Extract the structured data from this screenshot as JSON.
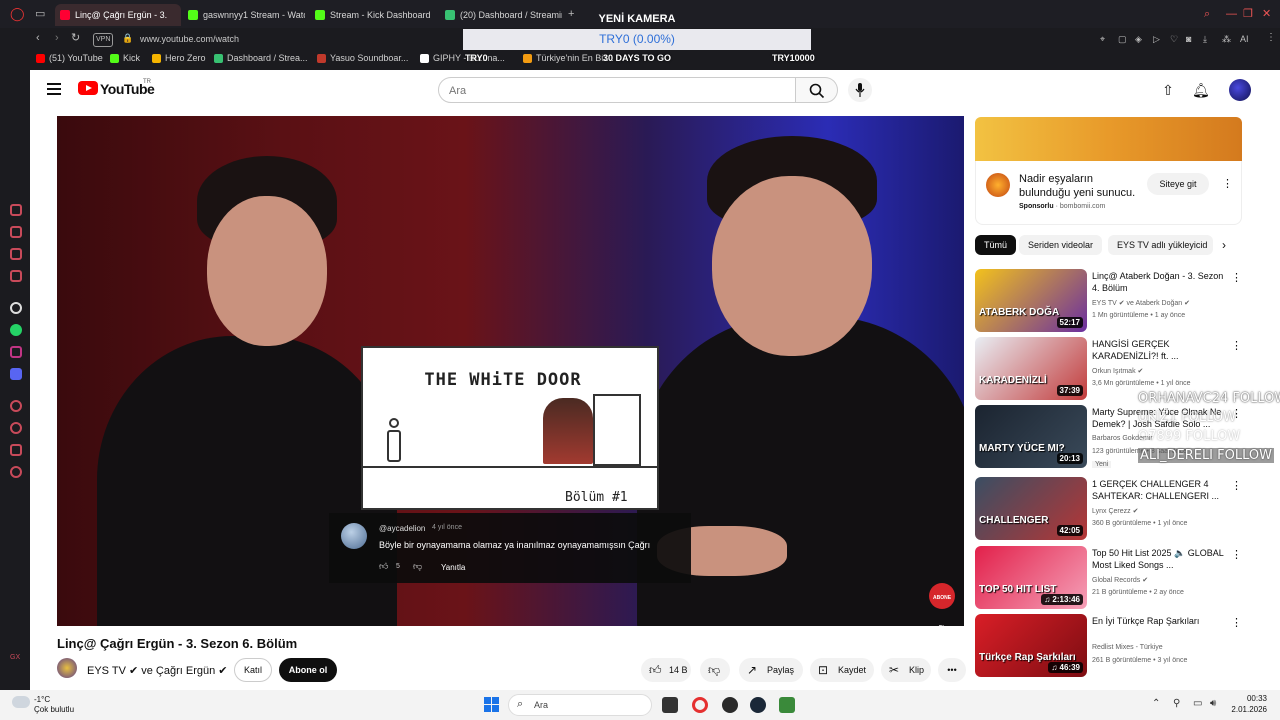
{
  "browser": {
    "tabs": [
      {
        "label": "Linç@ Çağrı Ergün - 3.",
        "active": true,
        "color": "#ff0033"
      },
      {
        "label": "gaswnnyy1 Stream - Watc",
        "active": false,
        "color": "#53fc18"
      },
      {
        "label": "Stream - Kick Dashboard",
        "active": false,
        "color": "#53fc18"
      },
      {
        "label": "(20) Dashboard / Streamin",
        "active": false,
        "color": "#38c172"
      }
    ],
    "new_tab": "+",
    "vpn_label": "VPN",
    "url": "www.youtube.com/watch",
    "toolbar_ai": "AI",
    "bookmarks": [
      {
        "label": "(51) YouTube",
        "color": "#ff0000"
      },
      {
        "label": "Kick",
        "color": "#53fc18"
      },
      {
        "label": "Hero Zero",
        "color": "#f5b400"
      },
      {
        "label": "Dashboard / Strea...",
        "color": "#38c172"
      },
      {
        "label": "Yasuo Soundboar...",
        "color": "#c0392b"
      },
      {
        "label": "GIPHY - Bu...na...",
        "color": "#ffffff"
      },
      {
        "label": "Türkiye'nin En Bü...",
        "color": "#f39c12"
      }
    ]
  },
  "overlay": {
    "title": "YENİ KAMERA",
    "goal_text": "TRY0 (0.00%)",
    "left_amount": "TRY0",
    "days_left": "30 DAYS TO GO",
    "goal_amount": "TRY10000",
    "progress_percent": 0
  },
  "youtube": {
    "logo": "YouTube",
    "country": "TR",
    "search_placeholder": "Ara",
    "video": {
      "title": "Linç@ Çağrı Ergün - 3. Sezon 6. Bölüm",
      "channel": "EYS TV ✔ ve Çağrı Ergün ✔",
      "join": "Katıl",
      "subscribe": "Abone ol",
      "likes": "14 B",
      "share": "Paylaş",
      "save": "Kaydet",
      "clip": "Klip",
      "more": "•••"
    },
    "inset": {
      "title": "THE WHiTE DOOR",
      "episode": "Bölüm #1"
    },
    "pinned_comment": {
      "user": "@aycadelion",
      "age": "4 yıl önce",
      "text": "Böyle bir oynayamama olamaz ya inanılmaz oynayamamışsın Çağrı",
      "likes": "5",
      "reply": "Yanıtla"
    },
    "abone_badge": "ABONE OL",
    "ad": {
      "text": "Nadir eşyaların bulunduğu yeni sunucu.",
      "sponsor_label": "Sponsorlu",
      "sponsor_domain": "bombomii.com",
      "cta": "Siteye git"
    },
    "chips": [
      "Tümü",
      "Seriden videolar",
      "EYS TV adlı yükleyicid"
    ],
    "recommendations": [
      {
        "title": "Linç@ Ataberk Doğan - 3. Sezon 4. Bölüm",
        "channel": "EYS TV ✔ ve Ataberk Doğan ✔",
        "meta": "1 Mn görüntüleme • 1 ay önce",
        "duration": "52:17",
        "thumb_text": "ATABERK DOĞA",
        "color1": "#f3c21c",
        "color2": "#6a2ea0"
      },
      {
        "title": "HANGİSİ GERÇEK KARADENİZLİ?! ft. ...",
        "channel": "Orkun Işıtmak ✔",
        "meta": "3,6 Mn görüntüleme • 1 yıl önce",
        "duration": "37:39",
        "thumb_text": "KARADENİZLİ",
        "color1": "#e9eef4",
        "color2": "#c23b3b"
      },
      {
        "title": "Marty Supreme: Yüce Olmak Ne Demek? | Josh Safdie Solo ...",
        "channel": "Barbaros Gokdemir",
        "meta": "123 görüntüleme • 8 saat önce",
        "duration": "20:13",
        "thumb_text": "MARTY YÜCE MI?",
        "color1": "#1b2430",
        "color2": "#3a4a5a",
        "badge": "Yeni"
      },
      {
        "title": "1 GERÇEK CHALLENGER 4 SAHTEKAR: CHALLENGERI ...",
        "channel": "Lynx Çerezz ✔",
        "meta": "360 B görüntüleme • 1 yıl önce",
        "duration": "42:05",
        "thumb_text": "CHALLENGER",
        "color1": "#3a4e63",
        "color2": "#b63636"
      },
      {
        "title": "Top 50 Hit List 2025 🔈 GLOBAL Most Liked Songs ...",
        "channel": "Global Records ✔",
        "meta": "21 B görüntüleme • 2 ay önce",
        "duration": "♫ 2:13:46",
        "thumb_text": "TOP 50 HIT LIST",
        "color1": "#e2204a",
        "color2": "#f5a0b8"
      },
      {
        "title": "En İyi Türkçe Rap Şarkıları",
        "channel": "Redlist Mixes - Türkiye",
        "meta": "261 B görüntüleme • 3 yıl önce",
        "duration": "♫ 46:39",
        "thumb_text": "Türkçe Rap Şarkıları",
        "color1": "#d91e27",
        "color2": "#7d0d12"
      }
    ],
    "follow_alerts": [
      "ORHANAVC24 FOLLOW",
      "UKIZ1 FOLLOW",
      "O7899 FOLLOW",
      "ALI_DERELI FOLLOW"
    ]
  },
  "taskbar": {
    "temp": "-1°C",
    "weather": "Çok bulutlu",
    "search": "Ara",
    "time": "00:33",
    "date": "2.01.2026"
  }
}
